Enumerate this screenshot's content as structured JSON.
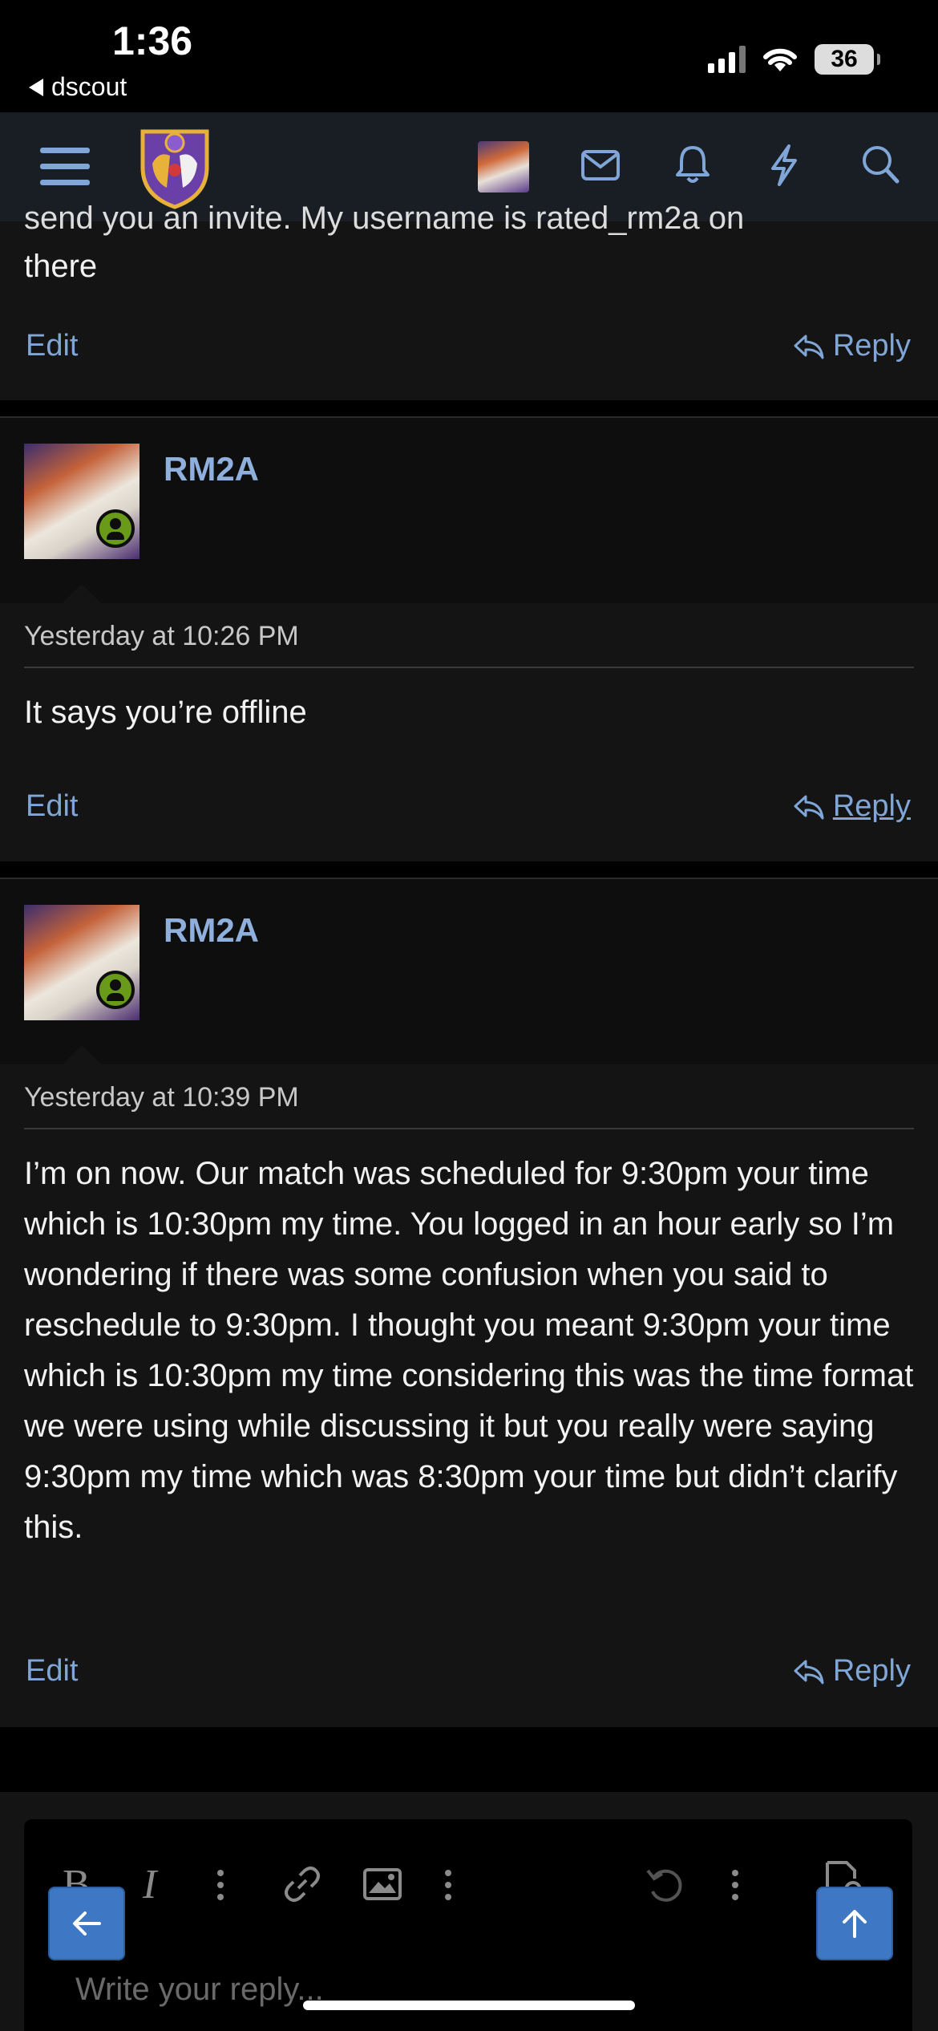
{
  "status": {
    "time": "1:36",
    "back_app": "dscout",
    "battery": "36"
  },
  "header": {
    "icons": [
      "menu-icon",
      "site-logo",
      "avatar",
      "mail-icon",
      "bell-icon",
      "lightning-icon",
      "search-icon"
    ]
  },
  "previous_post": {
    "clipped_line": "send you an invite. My username is rated_rm2a on",
    "text": "there",
    "edit_label": "Edit",
    "reply_label": "Reply"
  },
  "posts": [
    {
      "username": "RM2A",
      "date": "Yesterday at 10:26 PM",
      "body": "It says you’re offline",
      "edit_label": "Edit",
      "reply_label": "Reply"
    },
    {
      "username": "RM2A",
      "date": "Yesterday at 10:39 PM",
      "body": "I’m on now. Our match was scheduled for 9:30pm your time which is 10:30pm my time. You logged in an hour early so I’m wondering if there was some confusion when you said to reschedule to 9:30pm. I thought you meant 9:30pm your time which is 10:30pm my time considering this was the time format we were using while discussing it but you really were saying 9:30pm my time which was 8:30pm your time but didn’t clarify this.",
      "edit_label": "Edit",
      "reply_label": "Reply"
    }
  ],
  "editor": {
    "bold": "B",
    "italic": "I",
    "placeholder": "Write your reply..."
  },
  "colors": {
    "accent": "#7fa6d6",
    "username": "#8fb0dc",
    "fab": "#3e78c4",
    "online": "#6a9a1a"
  }
}
